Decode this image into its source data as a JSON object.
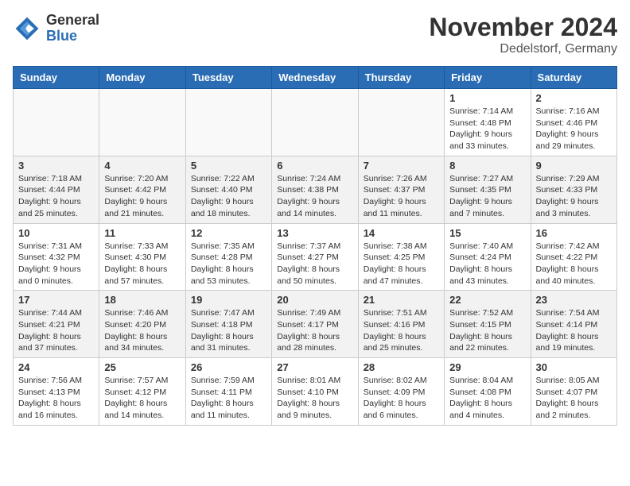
{
  "header": {
    "logo_general": "General",
    "logo_blue": "Blue",
    "month_title": "November 2024",
    "location": "Dedelstorf, Germany"
  },
  "calendar": {
    "days_of_week": [
      "Sunday",
      "Monday",
      "Tuesday",
      "Wednesday",
      "Thursday",
      "Friday",
      "Saturday"
    ],
    "weeks": [
      [
        {
          "day": "",
          "info": ""
        },
        {
          "day": "",
          "info": ""
        },
        {
          "day": "",
          "info": ""
        },
        {
          "day": "",
          "info": ""
        },
        {
          "day": "",
          "info": ""
        },
        {
          "day": "1",
          "info": "Sunrise: 7:14 AM\nSunset: 4:48 PM\nDaylight: 9 hours\nand 33 minutes."
        },
        {
          "day": "2",
          "info": "Sunrise: 7:16 AM\nSunset: 4:46 PM\nDaylight: 9 hours\nand 29 minutes."
        }
      ],
      [
        {
          "day": "3",
          "info": "Sunrise: 7:18 AM\nSunset: 4:44 PM\nDaylight: 9 hours\nand 25 minutes."
        },
        {
          "day": "4",
          "info": "Sunrise: 7:20 AM\nSunset: 4:42 PM\nDaylight: 9 hours\nand 21 minutes."
        },
        {
          "day": "5",
          "info": "Sunrise: 7:22 AM\nSunset: 4:40 PM\nDaylight: 9 hours\nand 18 minutes."
        },
        {
          "day": "6",
          "info": "Sunrise: 7:24 AM\nSunset: 4:38 PM\nDaylight: 9 hours\nand 14 minutes."
        },
        {
          "day": "7",
          "info": "Sunrise: 7:26 AM\nSunset: 4:37 PM\nDaylight: 9 hours\nand 11 minutes."
        },
        {
          "day": "8",
          "info": "Sunrise: 7:27 AM\nSunset: 4:35 PM\nDaylight: 9 hours\nand 7 minutes."
        },
        {
          "day": "9",
          "info": "Sunrise: 7:29 AM\nSunset: 4:33 PM\nDaylight: 9 hours\nand 3 minutes."
        }
      ],
      [
        {
          "day": "10",
          "info": "Sunrise: 7:31 AM\nSunset: 4:32 PM\nDaylight: 9 hours\nand 0 minutes."
        },
        {
          "day": "11",
          "info": "Sunrise: 7:33 AM\nSunset: 4:30 PM\nDaylight: 8 hours\nand 57 minutes."
        },
        {
          "day": "12",
          "info": "Sunrise: 7:35 AM\nSunset: 4:28 PM\nDaylight: 8 hours\nand 53 minutes."
        },
        {
          "day": "13",
          "info": "Sunrise: 7:37 AM\nSunset: 4:27 PM\nDaylight: 8 hours\nand 50 minutes."
        },
        {
          "day": "14",
          "info": "Sunrise: 7:38 AM\nSunset: 4:25 PM\nDaylight: 8 hours\nand 47 minutes."
        },
        {
          "day": "15",
          "info": "Sunrise: 7:40 AM\nSunset: 4:24 PM\nDaylight: 8 hours\nand 43 minutes."
        },
        {
          "day": "16",
          "info": "Sunrise: 7:42 AM\nSunset: 4:22 PM\nDaylight: 8 hours\nand 40 minutes."
        }
      ],
      [
        {
          "day": "17",
          "info": "Sunrise: 7:44 AM\nSunset: 4:21 PM\nDaylight: 8 hours\nand 37 minutes."
        },
        {
          "day": "18",
          "info": "Sunrise: 7:46 AM\nSunset: 4:20 PM\nDaylight: 8 hours\nand 34 minutes."
        },
        {
          "day": "19",
          "info": "Sunrise: 7:47 AM\nSunset: 4:18 PM\nDaylight: 8 hours\nand 31 minutes."
        },
        {
          "day": "20",
          "info": "Sunrise: 7:49 AM\nSunset: 4:17 PM\nDaylight: 8 hours\nand 28 minutes."
        },
        {
          "day": "21",
          "info": "Sunrise: 7:51 AM\nSunset: 4:16 PM\nDaylight: 8 hours\nand 25 minutes."
        },
        {
          "day": "22",
          "info": "Sunrise: 7:52 AM\nSunset: 4:15 PM\nDaylight: 8 hours\nand 22 minutes."
        },
        {
          "day": "23",
          "info": "Sunrise: 7:54 AM\nSunset: 4:14 PM\nDaylight: 8 hours\nand 19 minutes."
        }
      ],
      [
        {
          "day": "24",
          "info": "Sunrise: 7:56 AM\nSunset: 4:13 PM\nDaylight: 8 hours\nand 16 minutes."
        },
        {
          "day": "25",
          "info": "Sunrise: 7:57 AM\nSunset: 4:12 PM\nDaylight: 8 hours\nand 14 minutes."
        },
        {
          "day": "26",
          "info": "Sunrise: 7:59 AM\nSunset: 4:11 PM\nDaylight: 8 hours\nand 11 minutes."
        },
        {
          "day": "27",
          "info": "Sunrise: 8:01 AM\nSunset: 4:10 PM\nDaylight: 8 hours\nand 9 minutes."
        },
        {
          "day": "28",
          "info": "Sunrise: 8:02 AM\nSunset: 4:09 PM\nDaylight: 8 hours\nand 6 minutes."
        },
        {
          "day": "29",
          "info": "Sunrise: 8:04 AM\nSunset: 4:08 PM\nDaylight: 8 hours\nand 4 minutes."
        },
        {
          "day": "30",
          "info": "Sunrise: 8:05 AM\nSunset: 4:07 PM\nDaylight: 8 hours\nand 2 minutes."
        }
      ]
    ]
  }
}
